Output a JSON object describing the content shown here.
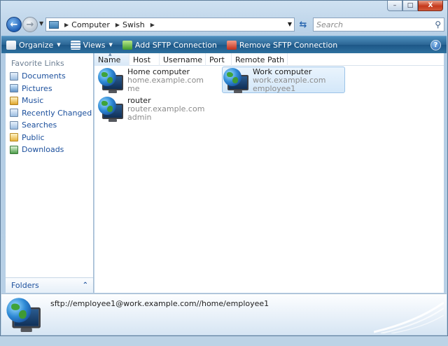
{
  "window": {
    "caption_buttons": {
      "minimize": "–",
      "maximize": "□",
      "close": "X"
    }
  },
  "nav": {
    "breadcrumbs": [
      "Computer",
      "Swish"
    ],
    "search_placeholder": "Search"
  },
  "toolbar": {
    "organize": "Organize",
    "views": "Views",
    "add_sftp": "Add SFTP Connection",
    "remove_sftp": "Remove SFTP Connection",
    "help": "?"
  },
  "sidebar": {
    "favorites_title": "Favorite Links",
    "items": [
      {
        "label": "Documents",
        "icon": "documents-icon"
      },
      {
        "label": "Pictures",
        "icon": "pictures-icon"
      },
      {
        "label": "Music",
        "icon": "music-icon"
      },
      {
        "label": "Recently Changed",
        "icon": "recently-changed-icon"
      },
      {
        "label": "Searches",
        "icon": "searches-icon"
      },
      {
        "label": "Public",
        "icon": "public-icon"
      },
      {
        "label": "Downloads",
        "icon": "downloads-icon"
      }
    ],
    "folders_label": "Folders"
  },
  "columns": [
    "Name",
    "Host",
    "Username",
    "Port",
    "Remote Path"
  ],
  "connections": [
    {
      "name": "Home computer",
      "host": "home.example.com",
      "user": "me"
    },
    {
      "name": "Work computer",
      "host": "work.example.com",
      "user": "employee1"
    },
    {
      "name": "router",
      "host": "router.example.com",
      "user": "admin"
    }
  ],
  "details": {
    "path": "sftp://employee1@work.example.com//home/employee1"
  }
}
